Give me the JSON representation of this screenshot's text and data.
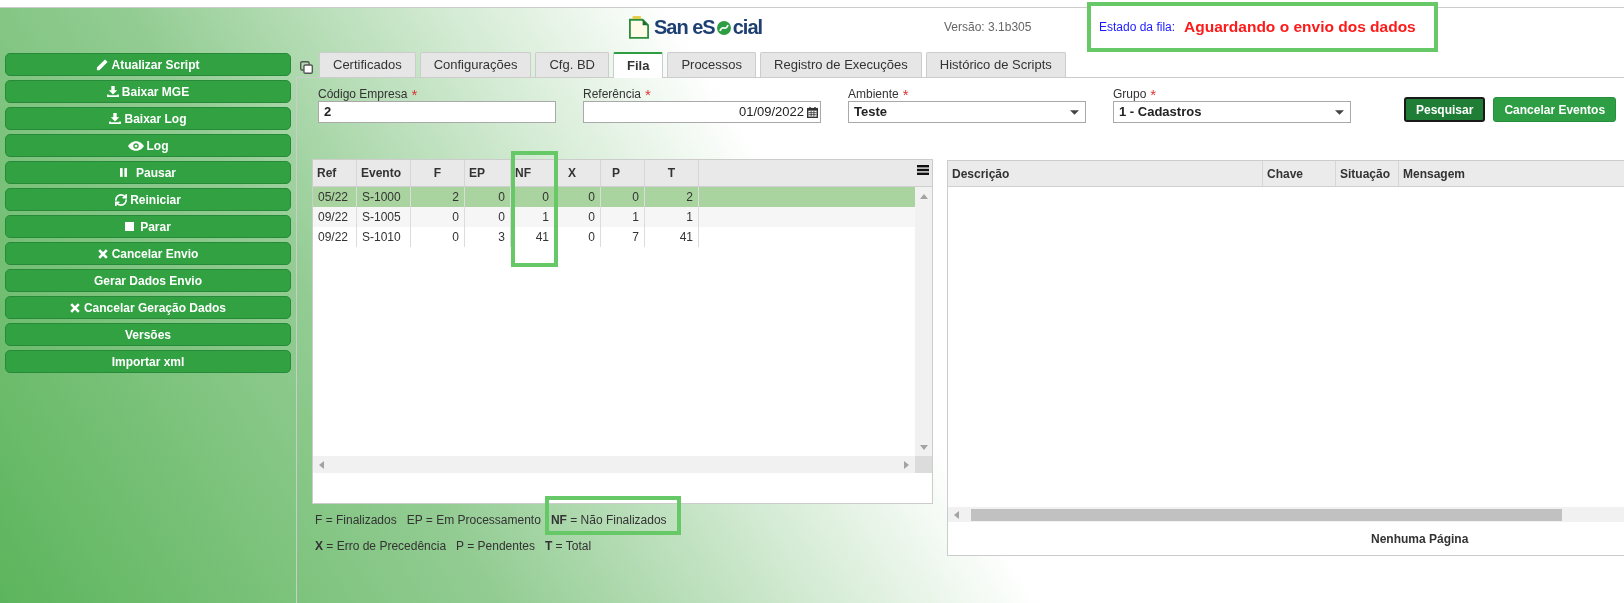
{
  "header": {
    "logo": {
      "prefix": "San eS",
      "suffix": "cial"
    },
    "version": "Versão: 3.1b305",
    "queue_status": {
      "label": "Estado da fila:",
      "value": "Aguardando o envio dos dados",
      "highlighted": true
    }
  },
  "sidebar": {
    "buttons": [
      {
        "kind": "edit",
        "label": "Atualizar Script"
      },
      {
        "kind": "download",
        "label": "Baixar MGE"
      },
      {
        "kind": "download",
        "label": "Baixar Log"
      },
      {
        "kind": "view",
        "label": "Log"
      },
      {
        "kind": "pause",
        "label": "Pausar"
      },
      {
        "kind": "restart",
        "label": "Reiniciar"
      },
      {
        "kind": "stop",
        "label": "Parar"
      },
      {
        "kind": "cancel",
        "label": "Cancelar Envio"
      },
      {
        "kind": "plain",
        "label": "Gerar Dados Envio"
      },
      {
        "kind": "cancel",
        "label": "Cancelar Geração Dados"
      },
      {
        "kind": "plain",
        "label": "Versões"
      },
      {
        "kind": "plain",
        "label": "Importar xml"
      }
    ]
  },
  "tabs": [
    {
      "label": "Certificados",
      "selected": false
    },
    {
      "label": "Configurações",
      "selected": false
    },
    {
      "label": "Cfg. BD",
      "selected": false
    },
    {
      "label": "Fila",
      "selected": true
    },
    {
      "label": "Processos",
      "selected": false
    },
    {
      "label": "Registro de Execuções",
      "selected": false
    },
    {
      "label": "Histórico de Scripts",
      "selected": false
    }
  ],
  "filters": {
    "fields": [
      {
        "kind": "text",
        "label": "Código Empresa",
        "required_mark": "*",
        "value": "2"
      },
      {
        "kind": "date",
        "label": "Referência",
        "required_mark": "*",
        "value": "01/09/2022"
      },
      {
        "kind": "select",
        "label": "Ambiente",
        "required_mark": "*",
        "value": "Teste"
      },
      {
        "kind": "select",
        "label": "Grupo",
        "required_mark": "*",
        "value": "1 - Cadastros"
      }
    ],
    "buttons": [
      {
        "label": "Pesquisar",
        "focused": true
      },
      {
        "label": "Cancelar Eventos",
        "focused": false
      }
    ]
  },
  "queue_table": {
    "columns": [
      {
        "label": "Ref",
        "highlighted": false
      },
      {
        "label": "Evento",
        "highlighted": false
      },
      {
        "label": "F",
        "highlighted": false
      },
      {
        "label": "EP",
        "highlighted": false
      },
      {
        "label": "NF",
        "highlighted": true
      },
      {
        "label": "X",
        "highlighted": false
      },
      {
        "label": "P",
        "highlighted": false
      },
      {
        "label": "T",
        "highlighted": false
      }
    ],
    "rows": [
      {
        "selected": true,
        "cells": [
          "05/22",
          "S-1000",
          "2",
          "0",
          "0",
          "0",
          "0",
          "2"
        ]
      },
      {
        "selected": false,
        "cells": [
          "09/22",
          "S-1005",
          "0",
          "0",
          "1",
          "0",
          "1",
          "1"
        ]
      },
      {
        "selected": false,
        "cells": [
          "09/22",
          "S-1010",
          "0",
          "3",
          "41",
          "0",
          "7",
          "41"
        ]
      }
    ]
  },
  "legend": [
    {
      "items": [
        {
          "text": "F = Finalizados",
          "highlighted": false
        },
        {
          "text": "EP = Em Processamento",
          "highlighted": false
        },
        {
          "text": "**NF** = Não Finalizados",
          "highlighted": true
        }
      ]
    },
    {
      "items": [
        {
          "text": "**X** = Erro de Precedência",
          "highlighted": false
        },
        {
          "text": "P = Pendentes",
          "highlighted": false
        },
        {
          "text": "**T** = Total",
          "highlighted": false
        }
      ]
    }
  ],
  "events_table": {
    "columns": [
      "Descrição",
      "Chave",
      "Situação",
      "Mensagem"
    ],
    "footer": "Nenhuma Página"
  }
}
